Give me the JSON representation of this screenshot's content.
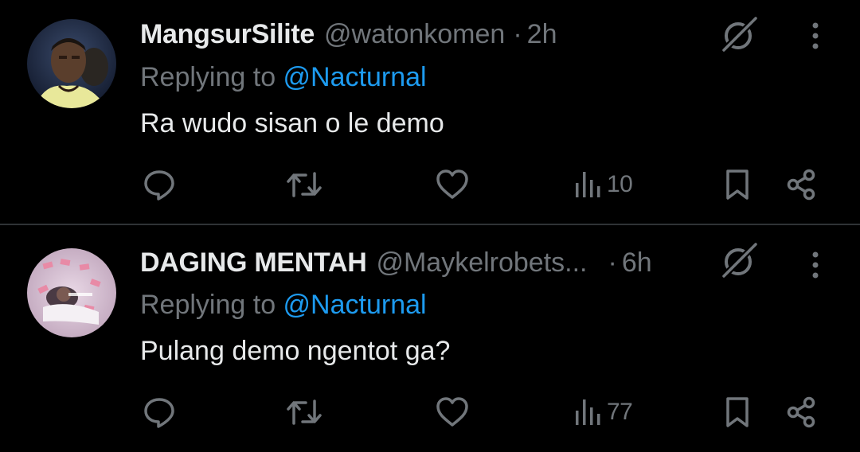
{
  "colors": {
    "background": "#000000",
    "primary_text": "#e7e9ea",
    "secondary_text": "#71767b",
    "accent": "#1d9bf0",
    "divider": "#2f3336"
  },
  "tweets": [
    {
      "display_name": "MangsurSilite",
      "handle": "@watonkomen",
      "separator": "·",
      "time": "2h",
      "replying_prefix": "Replying to ",
      "replying_to": "@Nacturnal",
      "text": "Ra wudo sisan o le demo",
      "views": "10",
      "icons": [
        "reply-icon",
        "retweet-icon",
        "like-icon",
        "views-icon",
        "bookmark-icon",
        "share-icon",
        "grok-icon",
        "more-icon"
      ]
    },
    {
      "display_name": "DAGING MENTAH",
      "handle": "@Maykelrobets...",
      "separator": "·",
      "time": "6h",
      "replying_prefix": "Replying to ",
      "replying_to": "@Nacturnal",
      "text": "Pulang demo ngentot ga?",
      "views": "77",
      "icons": [
        "reply-icon",
        "retweet-icon",
        "like-icon",
        "views-icon",
        "bookmark-icon",
        "share-icon",
        "grok-icon",
        "more-icon"
      ]
    }
  ]
}
